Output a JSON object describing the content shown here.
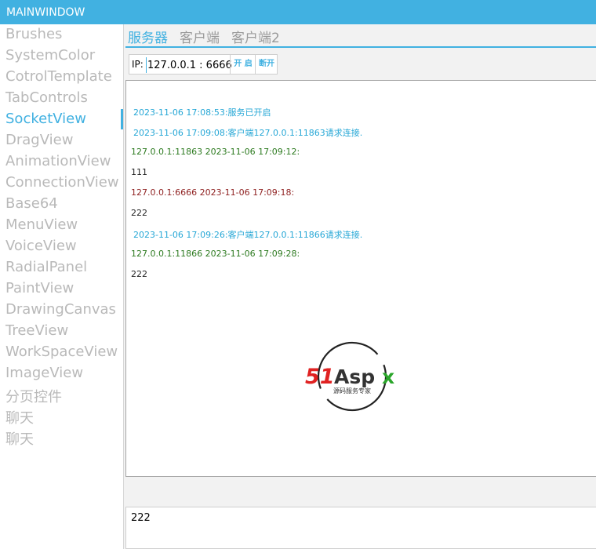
{
  "window": {
    "title": "MAINWINDOW"
  },
  "sidebar": {
    "items": [
      {
        "label": "Brushes"
      },
      {
        "label": "SystemColor"
      },
      {
        "label": "CotrolTemplate"
      },
      {
        "label": "TabControls"
      },
      {
        "label": "SocketView",
        "active": true
      },
      {
        "label": "DragView"
      },
      {
        "label": "AnimationView"
      },
      {
        "label": "ConnectionView"
      },
      {
        "label": "Base64"
      },
      {
        "label": "MenuView"
      },
      {
        "label": "VoiceView"
      },
      {
        "label": "RadialPanel"
      },
      {
        "label": "PaintView"
      },
      {
        "label": "DrawingCanvas"
      },
      {
        "label": "TreeView"
      },
      {
        "label": "WorkSpaceView"
      },
      {
        "label": "ImageView"
      },
      {
        "label": "分页控件"
      },
      {
        "label": "聊天"
      },
      {
        "label": "聊天"
      }
    ]
  },
  "tabs": [
    {
      "label": "服务器",
      "active": true
    },
    {
      "label": "客户端"
    },
    {
      "label": "客户端2"
    }
  ],
  "ipbar": {
    "ip_label": "IP:",
    "ip_value": "127.0.0.1 : 6666",
    "start_label": "开 启",
    "stop_label": "断开"
  },
  "messages": [
    {
      "type": "system",
      "text": "2023-11-06 17:08:53:服务已开启"
    },
    {
      "type": "system",
      "text": "2023-11-06 17:09:08:客户端127.0.0.1:11863请求连接."
    },
    {
      "type": "client",
      "text": "127.0.0.1:11863 2023-11-06 17:09:12:"
    },
    {
      "type": "body",
      "text": "111"
    },
    {
      "type": "server",
      "text": "127.0.0.1:6666 2023-11-06 17:09:18:"
    },
    {
      "type": "body",
      "text": "222"
    },
    {
      "type": "system",
      "text": "2023-11-06 17:09:26:客户端127.0.0.1:11866请求连接."
    },
    {
      "type": "client",
      "text": "127.0.0.1:11866 2023-11-06 17:09:28:"
    },
    {
      "type": "body",
      "text": "222"
    }
  ],
  "logo": {
    "brand": "51Aspx",
    "tagline": "源码服务专家"
  },
  "input": {
    "value": "222"
  },
  "colors": {
    "accent": "#41b1e1",
    "system_msg": "#26a7d6",
    "client_msg": "#2c7a1f",
    "server_msg": "#8e1f1f"
  }
}
